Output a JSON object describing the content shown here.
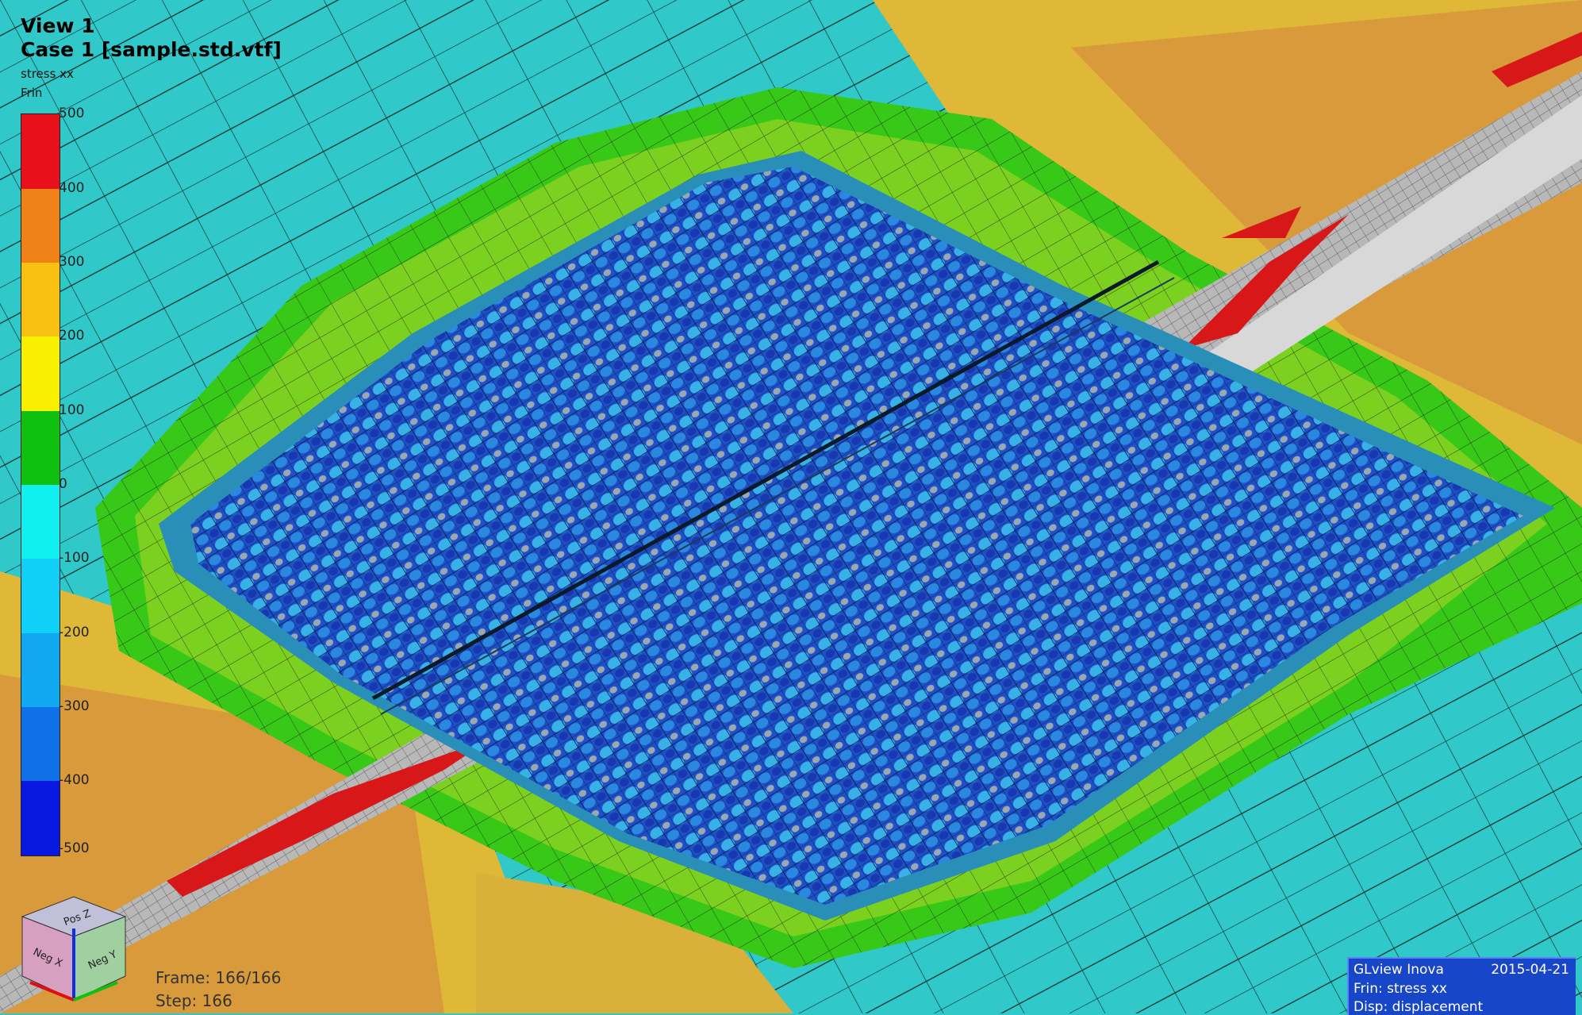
{
  "view": {
    "title": "View 1",
    "case_title": "Case 1  [sample.std.vtf]",
    "result_name": "stress xx",
    "result_kind": "Frin"
  },
  "legend": {
    "ticks": [
      "500",
      "400",
      "300",
      "200",
      "100",
      "0",
      "-100",
      "-200",
      "-300",
      "-400",
      "-500"
    ],
    "colors": [
      "#e8101a",
      "#f08018",
      "#f8c010",
      "#f8f000",
      "#10c010",
      "#10f0f0",
      "#10d0f8",
      "#10a8f0",
      "#1070e8",
      "#0818e0"
    ]
  },
  "orientation_cube": {
    "top_label": "Pos Z",
    "left_label": "Neg X",
    "right_label": "Neg Y"
  },
  "animation": {
    "frame_text": "Frame: 166/166",
    "step_text": "Step: 166"
  },
  "info_panel": {
    "app_name": "GLview Inova",
    "date": "2015-04-21",
    "frin_text": "Frin:  stress xx",
    "disp_text": "Disp:  displacement"
  }
}
